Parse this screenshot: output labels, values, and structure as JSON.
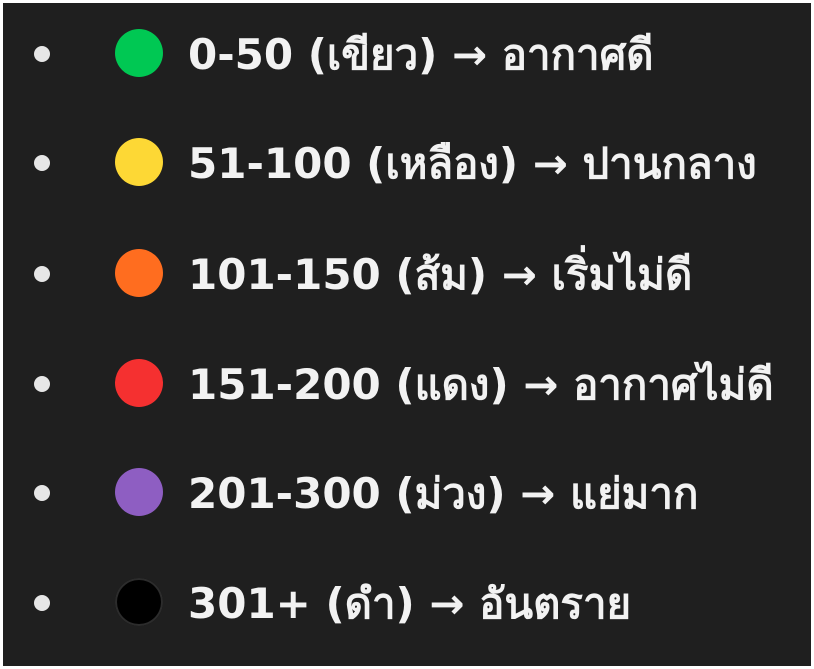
{
  "legend": {
    "items": [
      {
        "range": "0-50",
        "color_name": "เขียว",
        "meaning": "อากาศดี",
        "color": "#00c853"
      },
      {
        "range": "51-100",
        "color_name": "เหลือง",
        "meaning": "ปานกลาง",
        "color": "#fdd835"
      },
      {
        "range": "101-150",
        "color_name": "ส้ม",
        "meaning": "เริ่มไม่ดี",
        "color": "#ff6d1f"
      },
      {
        "range": "151-200",
        "color_name": "แดง",
        "meaning": "อากาศไม่ดี",
        "color": "#f53030"
      },
      {
        "range": "201-300",
        "color_name": "ม่วง",
        "meaning": "แย่มาก",
        "color": "#8e5ec2"
      },
      {
        "range": "301+",
        "color_name": "ดำ",
        "meaning": "อันตราย",
        "color": "#000000"
      }
    ],
    "labels": [
      "0-50 (เขียว) → อากาศดี",
      "51-100 (เหลือง) → ปานกลาง",
      "101-150 (ส้ม) → เริ่มไม่ดี",
      "151-200 (แดง) → อากาศไม่ดี",
      "201-300 (ม่วง) → แย่มาก",
      "301+ (ดำ) → อันตราย"
    ],
    "bullet_color": "#e6e6e6",
    "background_color": "#1f1f1f",
    "text_color": "#f2f2f2"
  }
}
